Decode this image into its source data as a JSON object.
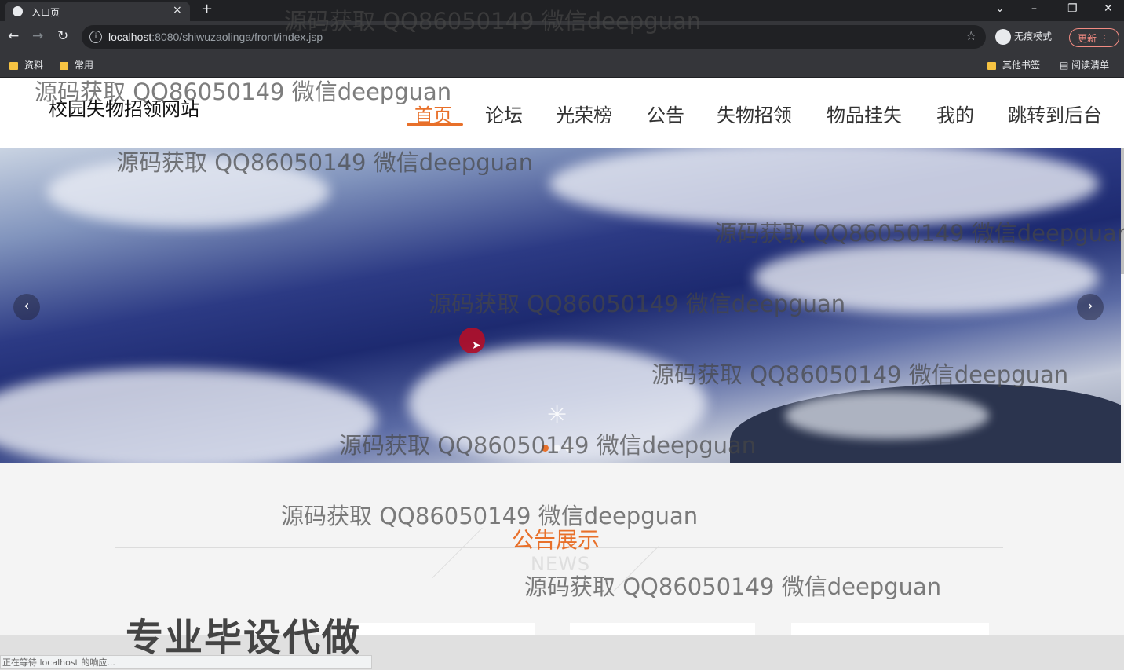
{
  "browser": {
    "tab_title": "入口页",
    "tab_close": "×",
    "new_tab": "+",
    "url_host": "localhost",
    "url_rest": ":8080/shiwuzaolinga/front/index.jsp",
    "incognito_label": "无痕模式",
    "update_label": "更新",
    "bookmarks": [
      "资料",
      "常用"
    ],
    "bookmarks_right": [
      "其他书签",
      "阅读清单"
    ]
  },
  "site": {
    "title": "校园失物招领网站",
    "nav": [
      "首页",
      "论坛",
      "光荣榜",
      "公告",
      "失物招领",
      "物品挂失",
      "我的",
      "跳转到后台"
    ],
    "active_nav_index": 0
  },
  "banner": {
    "prev_label": "‹",
    "next_label": "›",
    "slide_count": 3,
    "active_slide": 0
  },
  "section": {
    "title": "公告展示",
    "subtitle": "NEWS"
  },
  "promo": "专业毕设代做",
  "status_text": "正在等待 localhost 的响应...",
  "watermark": "源码获取 QQ86050149 微信deepguan",
  "colors": {
    "accent": "#e8702a",
    "chrome_dark": "#202124",
    "chrome": "#35363a"
  }
}
